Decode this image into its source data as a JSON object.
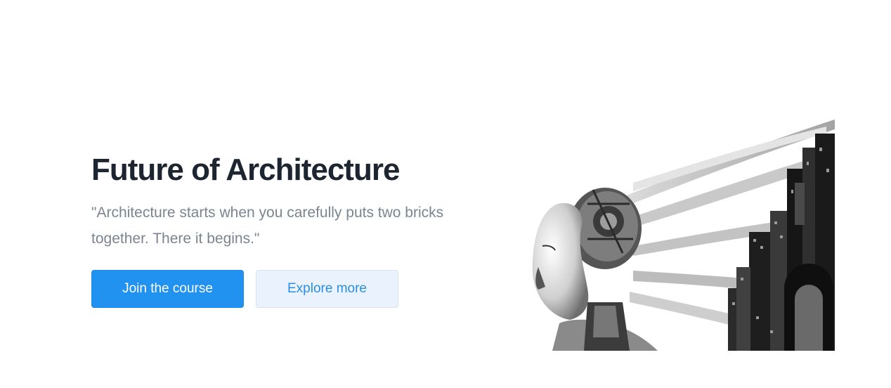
{
  "hero": {
    "title": "Future of Architecture",
    "quote": "\"Architecture starts when you carefully puts two bricks together. There it begins.\"",
    "primary_button_label": "Join the course",
    "secondary_button_label": "Explore more"
  },
  "colors": {
    "primary": "#2192f0",
    "secondary_bg": "#eaf3fd",
    "title": "#1c2530",
    "body_text": "#7a8591"
  }
}
